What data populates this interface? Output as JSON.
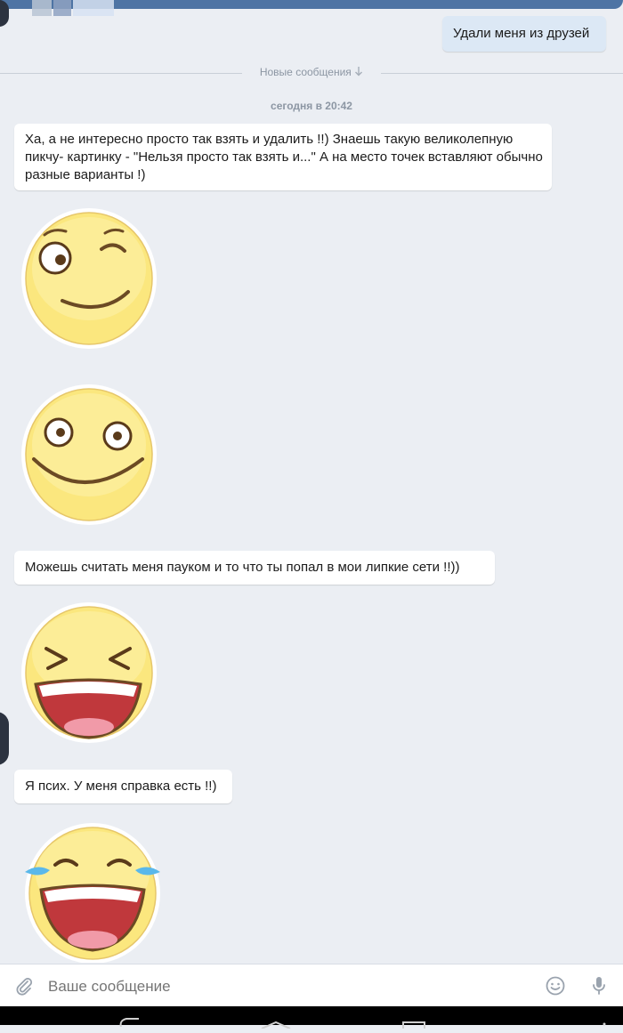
{
  "chat": {
    "outgoing": "Удали меня из друзей",
    "new_messages": "Новые сообщения",
    "date": "сегодня в 20:42",
    "messages": [
      "Ха, а не интересно просто так взять и удалить !!) Знаешь такую великолепную пикчу- картинку - \"Нельзя просто так взять и...\" А на место точек вставляют обычно разные варианты !)",
      "Можешь считать меня пауком и то что ты попал в мои липкие сети !!))",
      "Я псих. У меня справка есть !!)"
    ]
  },
  "composer": {
    "placeholder": "Ваше сообщение"
  },
  "icons": {
    "attach": "paperclip-icon",
    "emoji": "smile-icon",
    "mic": "microphone-icon",
    "new_messages_arrow": "arrow-down-icon"
  },
  "stickers": [
    "winking-smiley-sticker",
    "smiling-smiley-sticker",
    "laughing-smiley-sticker",
    "laughing-tears-smiley-sticker"
  ],
  "colors": {
    "background": "#ebeef3",
    "outgoing_bubble": "#dce8f5",
    "incoming_bubble": "#ffffff",
    "header": "#4e74a4"
  }
}
